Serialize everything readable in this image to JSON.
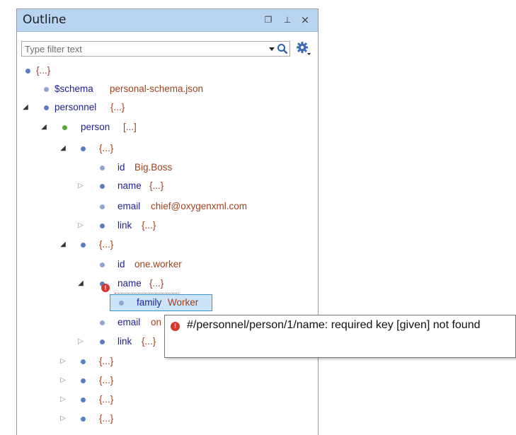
{
  "view": {
    "title": "Outline",
    "buttons": {
      "restore": "❐",
      "pin": "⊥",
      "close": "×"
    }
  },
  "filter": {
    "placeholder": "Type filter text",
    "value": ""
  },
  "tree": {
    "root": {
      "key": "{...}"
    },
    "schema": {
      "key": "$schema",
      "value": "personal-schema.json"
    },
    "personnel": {
      "key": "personnel",
      "value": "{...}"
    },
    "person": {
      "key": "person",
      "value": "[...]"
    },
    "obj0": {
      "key": "{...}"
    },
    "obj0_id": {
      "key": "id",
      "value": "Big.Boss"
    },
    "obj0_name": {
      "key": "name",
      "value": "{...}"
    },
    "obj0_email": {
      "key": "email",
      "value": "chief@oxygenxml.com"
    },
    "obj0_link": {
      "key": "link",
      "value": "{...}"
    },
    "obj1": {
      "key": "{...}"
    },
    "obj1_id": {
      "key": "id",
      "value": "one.worker"
    },
    "obj1_name": {
      "key": "name",
      "value": "{...}"
    },
    "obj1_family": {
      "key": "family",
      "value": "Worker"
    },
    "obj1_email": {
      "key": "email",
      "value": "on"
    },
    "obj1_link": {
      "key": "link",
      "value": "{...}"
    },
    "obj2": {
      "key": "{...}"
    },
    "obj3": {
      "key": "{...}"
    },
    "obj4": {
      "key": "{...}"
    },
    "obj5": {
      "key": "{...}"
    }
  },
  "tooltip": {
    "message": "#/personnel/person/1/name: required key [given] not found"
  },
  "colors": {
    "titlebar": "#b9d4f0",
    "key": "#1f1f8f",
    "value": "#a0401b",
    "object_node": "#5b7fc4",
    "array_node": "#5aa83a",
    "error": "#d9362e",
    "selection": "#cce4f7"
  }
}
